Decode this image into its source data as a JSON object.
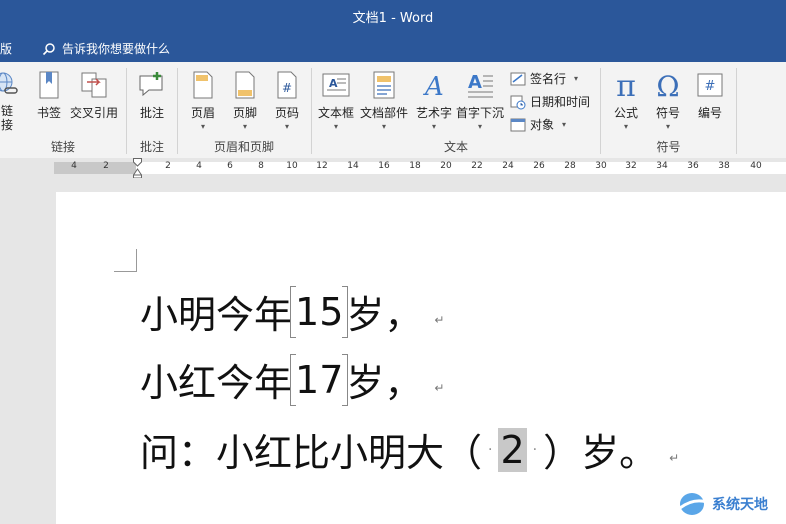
{
  "window": {
    "title": "文档1  -  Word"
  },
  "tabs_row": {
    "partial_tab": "排版",
    "tell_me": "告诉我你想要做什么"
  },
  "ribbon": {
    "groups": {
      "links": {
        "label": "链接",
        "items": [
          {
            "label": "链\n接",
            "icon": "link-icon"
          },
          {
            "label": "书签",
            "icon": "bookmark-icon"
          },
          {
            "label": "交叉引用",
            "icon": "cross-reference-icon"
          }
        ]
      },
      "comments": {
        "label": "批注",
        "items": [
          {
            "label": "批注",
            "icon": "comment-icon"
          }
        ]
      },
      "header_footer": {
        "label": "页眉和页脚",
        "items": [
          {
            "label": "页眉",
            "icon": "header-icon"
          },
          {
            "label": "页脚",
            "icon": "footer-icon"
          },
          {
            "label": "页码",
            "icon": "page-number-icon"
          }
        ]
      },
      "text": {
        "label": "文本",
        "items": [
          {
            "label": "文本框",
            "icon": "textbox-icon"
          },
          {
            "label": "文档部件",
            "icon": "quick-parts-icon"
          },
          {
            "label": "艺术字",
            "icon": "wordart-icon"
          },
          {
            "label": "首字下沉",
            "icon": "drop-cap-icon"
          }
        ],
        "small_items": [
          {
            "label": "签名行",
            "icon": "signature-line-icon"
          },
          {
            "label": "日期和时间",
            "icon": "date-time-icon"
          },
          {
            "label": "对象",
            "icon": "object-icon"
          }
        ]
      },
      "symbols": {
        "label": "符号",
        "items": [
          {
            "label": "公式",
            "icon": "equation-icon"
          },
          {
            "label": "符号",
            "icon": "symbol-icon"
          },
          {
            "label": "编号",
            "icon": "number-icon"
          }
        ]
      }
    }
  },
  "ruler": {
    "labels": [
      "4",
      "2",
      "2",
      "4",
      "6",
      "8",
      "10",
      "12",
      "14",
      "16",
      "18",
      "20",
      "22",
      "24",
      "26",
      "28",
      "30",
      "32",
      "34",
      "36",
      "38",
      "40"
    ]
  },
  "document": {
    "lines": [
      {
        "prefix": "小明今年",
        "field": "15",
        "suffix": "岁，",
        "mark": "↵"
      },
      {
        "prefix": "小红今年",
        "field": "17",
        "suffix": "岁，",
        "mark": "↵"
      },
      {
        "prefix": "问：小红比小明大（",
        "answer": "2",
        "suffix": "）岁。",
        "mark": "↵"
      }
    ]
  },
  "watermark": {
    "text": "系统天地"
  },
  "colors": {
    "title_bar": "#2b579a",
    "accent_blue": "#2b579a"
  }
}
